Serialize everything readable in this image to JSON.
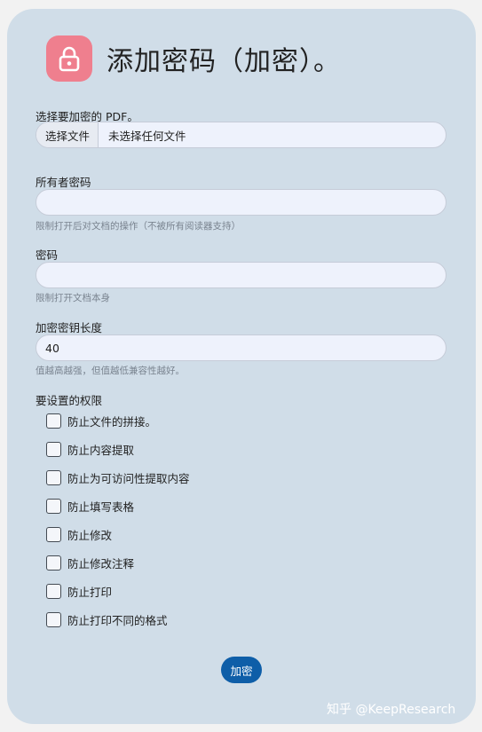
{
  "page": {
    "title": "添加密码（加密）。",
    "icon": "lock-icon",
    "icon_bg": "#ef7f8e",
    "card_bg": "#d0dde8"
  },
  "file": {
    "label": "选择要加密的 PDF。",
    "button_label": "选择文件",
    "status": "未选择任何文件"
  },
  "owner_password": {
    "label": "所有者密码",
    "value": "",
    "hint": "限制打开后对文档的操作（不被所有阅读器支持）"
  },
  "password": {
    "label": "密码",
    "value": "",
    "hint": "限制打开文档本身"
  },
  "key_length": {
    "label": "加密密钥长度",
    "value": "40",
    "hint": "值越高越强，但值越低兼容性越好。"
  },
  "permissions": {
    "label": "要设置的权限",
    "items": [
      {
        "label": "防止文件的拼接。",
        "checked": false
      },
      {
        "label": "防止内容提取",
        "checked": false
      },
      {
        "label": "防止为可访问性提取内容",
        "checked": false
      },
      {
        "label": "防止填写表格",
        "checked": false
      },
      {
        "label": "防止修改",
        "checked": false
      },
      {
        "label": "防止修改注释",
        "checked": false
      },
      {
        "label": "防止打印",
        "checked": false
      },
      {
        "label": "防止打印不同的格式",
        "checked": false
      }
    ]
  },
  "submit_label": "加密",
  "watermark": "知乎 @KeepResearch",
  "accent_color": "#0e5ea8"
}
